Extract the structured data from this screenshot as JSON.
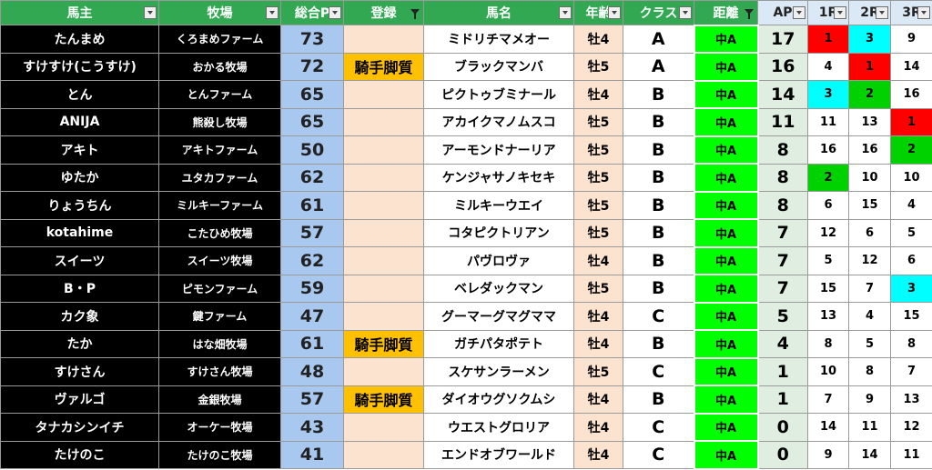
{
  "headers": {
    "owner": "馬主",
    "ranch": "牧場",
    "points": "総合P",
    "register": "登録",
    "horse": "馬名",
    "age": "年齢",
    "class": "クラス",
    "distance": "距離",
    "ap": "AP",
    "r1": "1R",
    "r2": "2R",
    "r3": "3R"
  },
  "rows": [
    {
      "owner": "たんまめ",
      "ranch": "くろまめファーム",
      "points": "73",
      "register": "",
      "horse": "ミドリチマメオー",
      "age": "牡4",
      "class": "A",
      "distance": "中A",
      "ap": "17",
      "r1": "1",
      "r2": "3",
      "r3": "9"
    },
    {
      "owner": "すけすけ(こうすけ)",
      "ranch": "おかる牧場",
      "points": "72",
      "register": "騎手脚質",
      "horse": "ブラックマンバ",
      "age": "牡5",
      "class": "A",
      "distance": "中A",
      "ap": "16",
      "r1": "4",
      "r2": "1",
      "r3": "14"
    },
    {
      "owner": "とん",
      "ranch": "とんファーム",
      "points": "65",
      "register": "",
      "horse": "ピクトゥブミナール",
      "age": "牡4",
      "class": "B",
      "distance": "中A",
      "ap": "14",
      "r1": "3",
      "r2": "2",
      "r3": "16"
    },
    {
      "owner": "ANIJA",
      "ranch": "熊殺し牧場",
      "points": "65",
      "register": "",
      "horse": "アカイクマノムスコ",
      "age": "牡5",
      "class": "B",
      "distance": "中A",
      "ap": "11",
      "r1": "11",
      "r2": "13",
      "r3": "1"
    },
    {
      "owner": "アキト",
      "ranch": "アキトファーム",
      "points": "50",
      "register": "",
      "horse": "アーモンドナーリア",
      "age": "牡5",
      "class": "B",
      "distance": "中A",
      "ap": "8",
      "r1": "16",
      "r2": "16",
      "r3": "2"
    },
    {
      "owner": "ゆたか",
      "ranch": "ユタカファーム",
      "points": "62",
      "register": "",
      "horse": "ケンジャサノキセキ",
      "age": "牡5",
      "class": "B",
      "distance": "中A",
      "ap": "8",
      "r1": "2",
      "r2": "10",
      "r3": "10"
    },
    {
      "owner": "りょうちん",
      "ranch": "ミルキーファーム",
      "points": "61",
      "register": "",
      "horse": "ミルキーウエイ",
      "age": "牡5",
      "class": "B",
      "distance": "中A",
      "ap": "8",
      "r1": "6",
      "r2": "15",
      "r3": "4"
    },
    {
      "owner": "kotahime",
      "ranch": "こたひめ牧場",
      "points": "57",
      "register": "",
      "horse": "コタピクトリアン",
      "age": "牡5",
      "class": "B",
      "distance": "中A",
      "ap": "7",
      "r1": "12",
      "r2": "6",
      "r3": "5"
    },
    {
      "owner": "スイーツ",
      "ranch": "スイーツ牧場",
      "points": "62",
      "register": "",
      "horse": "パヴロヴァ",
      "age": "牡4",
      "class": "B",
      "distance": "中A",
      "ap": "7",
      "r1": "5",
      "r2": "12",
      "r3": "6"
    },
    {
      "owner": "B・P",
      "ranch": "ピモンファーム",
      "points": "59",
      "register": "",
      "horse": "ベレダックマン",
      "age": "牡5",
      "class": "B",
      "distance": "中A",
      "ap": "7",
      "r1": "15",
      "r2": "7",
      "r3": "3"
    },
    {
      "owner": "カク象",
      "ranch": "鍵ファーム",
      "points": "47",
      "register": "",
      "horse": "グーマーグマグママ",
      "age": "牡4",
      "class": "C",
      "distance": "中A",
      "ap": "5",
      "r1": "13",
      "r2": "4",
      "r3": "15"
    },
    {
      "owner": "たか",
      "ranch": "はな畑牧場",
      "points": "61",
      "register": "騎手脚質",
      "horse": "ガチパタポテト",
      "age": "牡4",
      "class": "B",
      "distance": "中A",
      "ap": "4",
      "r1": "8",
      "r2": "5",
      "r3": "8"
    },
    {
      "owner": "すけさん",
      "ranch": "すけさん牧場",
      "points": "48",
      "register": "",
      "horse": "スケサンラーメン",
      "age": "牡5",
      "class": "C",
      "distance": "中A",
      "ap": "1",
      "r1": "10",
      "r2": "8",
      "r3": "7"
    },
    {
      "owner": "ヴァルゴ",
      "ranch": "金銀牧場",
      "points": "57",
      "register": "騎手脚質",
      "horse": "ダイオウグソクムシ",
      "age": "牡4",
      "class": "B",
      "distance": "中A",
      "ap": "1",
      "r1": "7",
      "r2": "9",
      "r3": "13"
    },
    {
      "owner": "タナカシンイチ",
      "ranch": "オーケー牧場",
      "points": "43",
      "register": "",
      "horse": "ウエストグロリア",
      "age": "牡4",
      "class": "C",
      "distance": "中A",
      "ap": "0",
      "r1": "14",
      "r2": "11",
      "r3": "12"
    },
    {
      "owner": "たけのこ",
      "ranch": "たけのこ牧場",
      "points": "41",
      "register": "",
      "horse": "エンドオブワールド",
      "age": "牡4",
      "class": "C",
      "distance": "中A",
      "ap": "0",
      "r1": "9",
      "r2": "14",
      "r3": "11"
    }
  ],
  "highlight_colors": {
    "rank_1": "#ff0000",
    "rank_2": "#00d200",
    "rank_3": "#00ffff",
    "register_on": "#ffc000",
    "header": "#32a852",
    "distance": "#00ff00"
  }
}
